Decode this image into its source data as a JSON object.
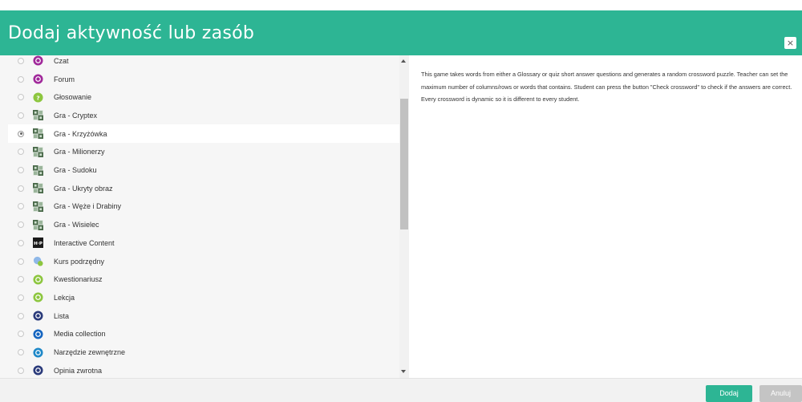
{
  "dialog": {
    "title": "Dodaj aktywność lub zasób",
    "close_label": "×"
  },
  "list": {
    "selected_index": 4,
    "items": [
      {
        "label": "Czat",
        "icon": "chat-icon",
        "icon_color": "#a0289a"
      },
      {
        "label": "Forum",
        "icon": "forum-icon",
        "icon_color": "#a0289a"
      },
      {
        "label": "Głosowanie",
        "icon": "poll-icon",
        "icon_color": "#8dc63f"
      },
      {
        "label": "Gra - Cryptex",
        "icon": "game-icon",
        "icon_color": "#557755"
      },
      {
        "label": "Gra - Krzyżówka",
        "icon": "game-icon",
        "icon_color": "#557755"
      },
      {
        "label": "Gra - Milionerzy",
        "icon": "game-icon",
        "icon_color": "#557755"
      },
      {
        "label": "Gra - Sudoku",
        "icon": "game-icon",
        "icon_color": "#557755"
      },
      {
        "label": "Gra - Ukryty obraz",
        "icon": "game-icon",
        "icon_color": "#557755"
      },
      {
        "label": "Gra - Węże i Drabiny",
        "icon": "game-icon",
        "icon_color": "#557755"
      },
      {
        "label": "Gra - Wisielec",
        "icon": "game-icon",
        "icon_color": "#557755"
      },
      {
        "label": "Interactive Content",
        "icon": "h5p-icon",
        "icon_color": "#1a1a1a"
      },
      {
        "label": "Kurs podrzędny",
        "icon": "subcourse-icon",
        "icon_color": "#5b9bd5"
      },
      {
        "label": "Kwestionariusz",
        "icon": "questionnaire-icon",
        "icon_color": "#8dc63f"
      },
      {
        "label": "Lekcja",
        "icon": "lesson-icon",
        "icon_color": "#8dc63f"
      },
      {
        "label": "Lista",
        "icon": "list-icon",
        "icon_color": "#2a3a7a"
      },
      {
        "label": "Media collection",
        "icon": "media-icon",
        "icon_color": "#1565c0"
      },
      {
        "label": "Narzędzie zewnętrzne",
        "icon": "external-tool-icon",
        "icon_color": "#1e88c8"
      },
      {
        "label": "Opinia zwrotna",
        "icon": "feedback-icon",
        "icon_color": "#2a3a7a"
      },
      {
        "label": "",
        "icon": "partial-icon",
        "icon_color": "#8dc63f"
      }
    ]
  },
  "description": "This game takes words from either a Glossary or quiz short answer questions and generates a random crossword puzzle. Teacher can set the maximum number of columns/rows or words that contains. Student can press the button \"Check crossword\" to check if the answers are correct. Every crossword is dynamic so it is different to every student.",
  "footer": {
    "add_label": "Dodaj",
    "cancel_label": "Anuluj"
  }
}
